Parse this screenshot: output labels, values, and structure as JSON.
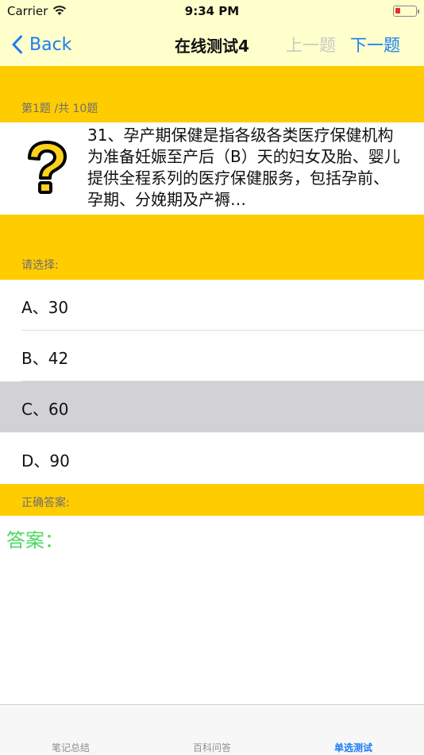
{
  "status": {
    "carrier": "Carrier",
    "time": "9:34 PM"
  },
  "nav": {
    "back_label": "Back",
    "title": "在线测试4",
    "prev_label": "上一题",
    "next_label": "下一题"
  },
  "progress_label": "第1题 /共 10题",
  "question": {
    "text": "31、孕产期保健是指各级各类医疗保健机构为准备妊娠至产后（B）天的妇女及胎、婴儿提供全程系列的医疗保健服务，包括孕前、孕期、分娩期及产褥…",
    "icon": "question-mark-icon"
  },
  "choose_label": "请选择:",
  "options": [
    {
      "label": "A、30",
      "selected": false
    },
    {
      "label": "B、42",
      "selected": false
    },
    {
      "label": "C、60",
      "selected": true
    },
    {
      "label": "D、90",
      "selected": false
    }
  ],
  "answer_header": "正确答案:",
  "answer_text": "答案：",
  "tabs": [
    {
      "label": "笔记总结",
      "active": false
    },
    {
      "label": "百科问答",
      "active": false
    },
    {
      "label": "单选测试",
      "active": true
    }
  ],
  "colors": {
    "accent": "#1a7cf5",
    "band": "#ffcc00",
    "nav_bg": "#ffffcc",
    "answer": "#4cd964",
    "selected_row": "#d1d1d6"
  }
}
